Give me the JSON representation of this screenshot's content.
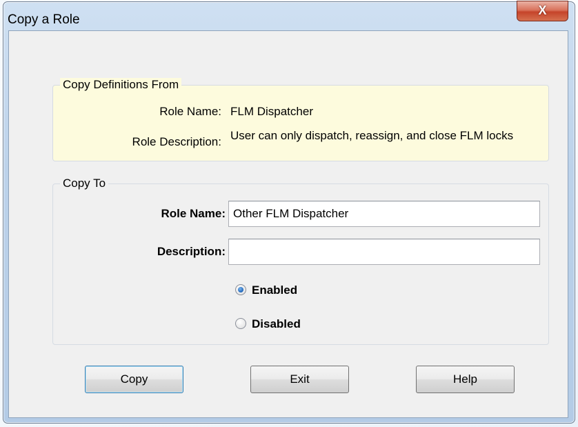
{
  "window": {
    "title": "Copy a Role",
    "close_glyph": "X"
  },
  "copy_from": {
    "legend": "Copy Definitions From",
    "role_name_label": "Role Name:",
    "role_name_value": "FLM Dispatcher",
    "role_description_label": "Role Description:",
    "role_description_value": "User can only dispatch, reassign, and close FLM locks"
  },
  "copy_to": {
    "legend": "Copy To",
    "role_name_label": "Role Name:",
    "role_name_value": "Other FLM Dispatcher",
    "description_label": "Description:",
    "description_value": "",
    "status_options": [
      {
        "label": "Enabled",
        "checked": true
      },
      {
        "label": "Disabled",
        "checked": false
      }
    ]
  },
  "buttons": {
    "copy": "Copy",
    "exit": "Exit",
    "help": "Help"
  },
  "colors": {
    "info_panel_bg": "#fdfbdd",
    "dialog_bg": "#f0f0f0",
    "close_button": "#c5442a",
    "default_button_border": "#3c7fb1"
  },
  "icons": {
    "close": "close-icon",
    "radio_checked": "radio-checked-icon",
    "radio_unchecked": "radio-unchecked-icon"
  }
}
